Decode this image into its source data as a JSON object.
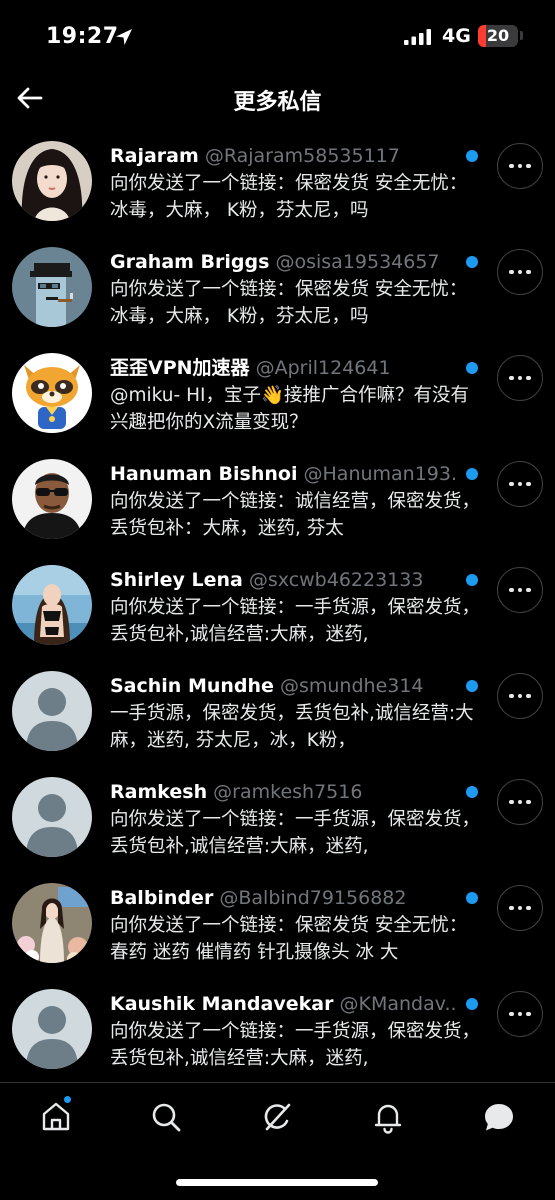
{
  "status_bar": {
    "time": "19:27",
    "network": "4G",
    "battery": "20",
    "battery_fraction": 0.2,
    "battery_color": "#ff3b30"
  },
  "header": {
    "title": "更多私信",
    "back_icon": "arrow-left-icon"
  },
  "conversations": [
    {
      "name": "Rajaram",
      "handle": "@Rajaram58535117",
      "message": "向你发送了一个链接：保密发货 安全无忧：冰毒，大麻， K粉，芬太尼，吗",
      "avatar": "photo-woman-portrait",
      "unread": true
    },
    {
      "name": "Graham Briggs",
      "handle": "@osisa19534657",
      "message": "向你发送了一个链接：保密发货 安全无忧：冰毒，大麻， K粉，芬太尼，吗",
      "avatar": "pixel-art-punk",
      "unread": true
    },
    {
      "name": "歪歪VPN加速器",
      "handle": "@April124641",
      "message": "@miku- HI，宝子👋接推广合作嘛？有没有兴趣把你的X流量变现？",
      "avatar": "raccoon-mascot",
      "unread": true
    },
    {
      "name": "Hanuman Bishnoi",
      "handle": "@Hanuman193...",
      "message": "向你发送了一个链接：诚信经营，保密发货，丢货包补：大麻，迷药, 芬太",
      "avatar": "photo-man-sunglasses",
      "unread": true
    },
    {
      "name": "Shirley Lena",
      "handle": "@sxcwb46223133",
      "message": "向你发送了一个链接：一手货源，保密发货，丢货包补,诚信经营:大麻，迷药,",
      "avatar": "photo-woman-pool",
      "unread": true
    },
    {
      "name": "Sachin Mundhe",
      "handle": "@smundhe314",
      "message": "一手货源，保密发货，丢货包补,诚信经营:大麻，迷药, 芬太尼，冰，K粉，",
      "avatar": "default-profile",
      "unread": true
    },
    {
      "name": "Ramkesh",
      "handle": "@ramkesh7516",
      "message": "向你发送了一个链接：一手货源，保密发货，丢货包补,诚信经营:大麻，迷药,",
      "avatar": "default-profile",
      "unread": true
    },
    {
      "name": "Balbinder",
      "handle": "@Balbind79156882",
      "message": "向你发送了一个链接：保密发货 安全无忧： 春药 迷药 催情药 针孔摄像头 冰 大",
      "avatar": "photo-woman-flowers",
      "unread": true
    },
    {
      "name": "Kaushik Mandavekar",
      "handle": "@KMandav...",
      "message": "向你发送了一个链接：一手货源，保密发货，丢货包补,诚信经营:大麻，迷药,",
      "avatar": "default-profile",
      "unread": true
    }
  ],
  "tabbar": {
    "items": [
      "home-icon",
      "search-icon",
      "grok-icon",
      "bell-icon",
      "messages-icon"
    ],
    "active": "messages-icon",
    "accent": "#1d9bf0"
  }
}
